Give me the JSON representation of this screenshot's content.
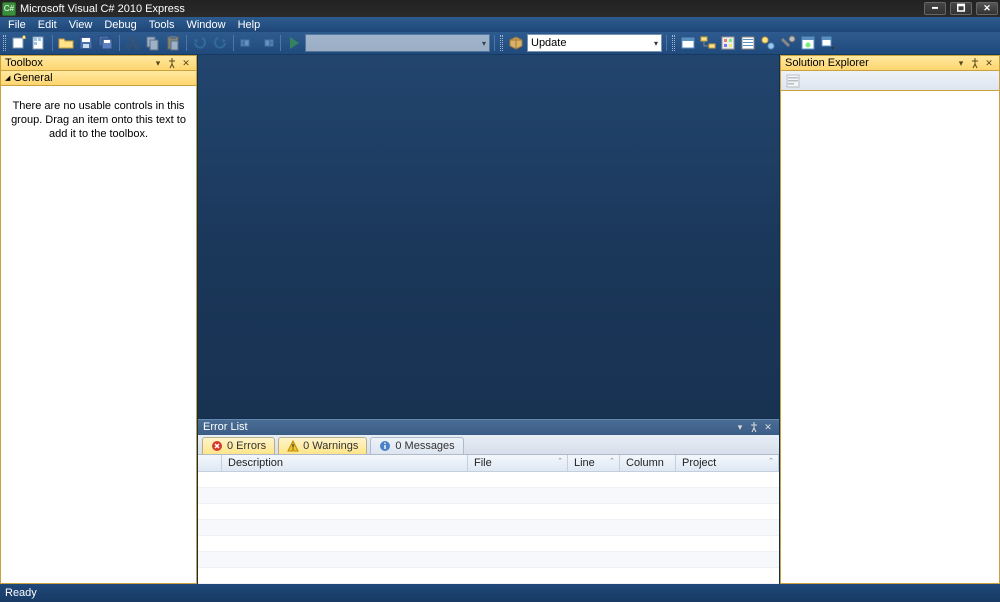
{
  "titlebar": {
    "title": "Microsoft Visual C# 2010 Express"
  },
  "menu": {
    "items": [
      "File",
      "Edit",
      "View",
      "Debug",
      "Tools",
      "Window",
      "Help"
    ]
  },
  "toolbar": {
    "config_combo": "",
    "update_combo": "Update"
  },
  "toolbox": {
    "title": "Toolbox",
    "category": "General",
    "empty_msg": "There are no usable controls in this group. Drag an item onto this text to add it to the toolbox."
  },
  "solution_explorer": {
    "title": "Solution Explorer"
  },
  "error_list": {
    "title": "Error List",
    "tabs": {
      "errors": "0 Errors",
      "warnings": "0 Warnings",
      "messages": "0 Messages"
    },
    "columns": [
      "",
      "Description",
      "File",
      "Line",
      "Column",
      "Project"
    ]
  },
  "statusbar": {
    "text": "Ready"
  }
}
